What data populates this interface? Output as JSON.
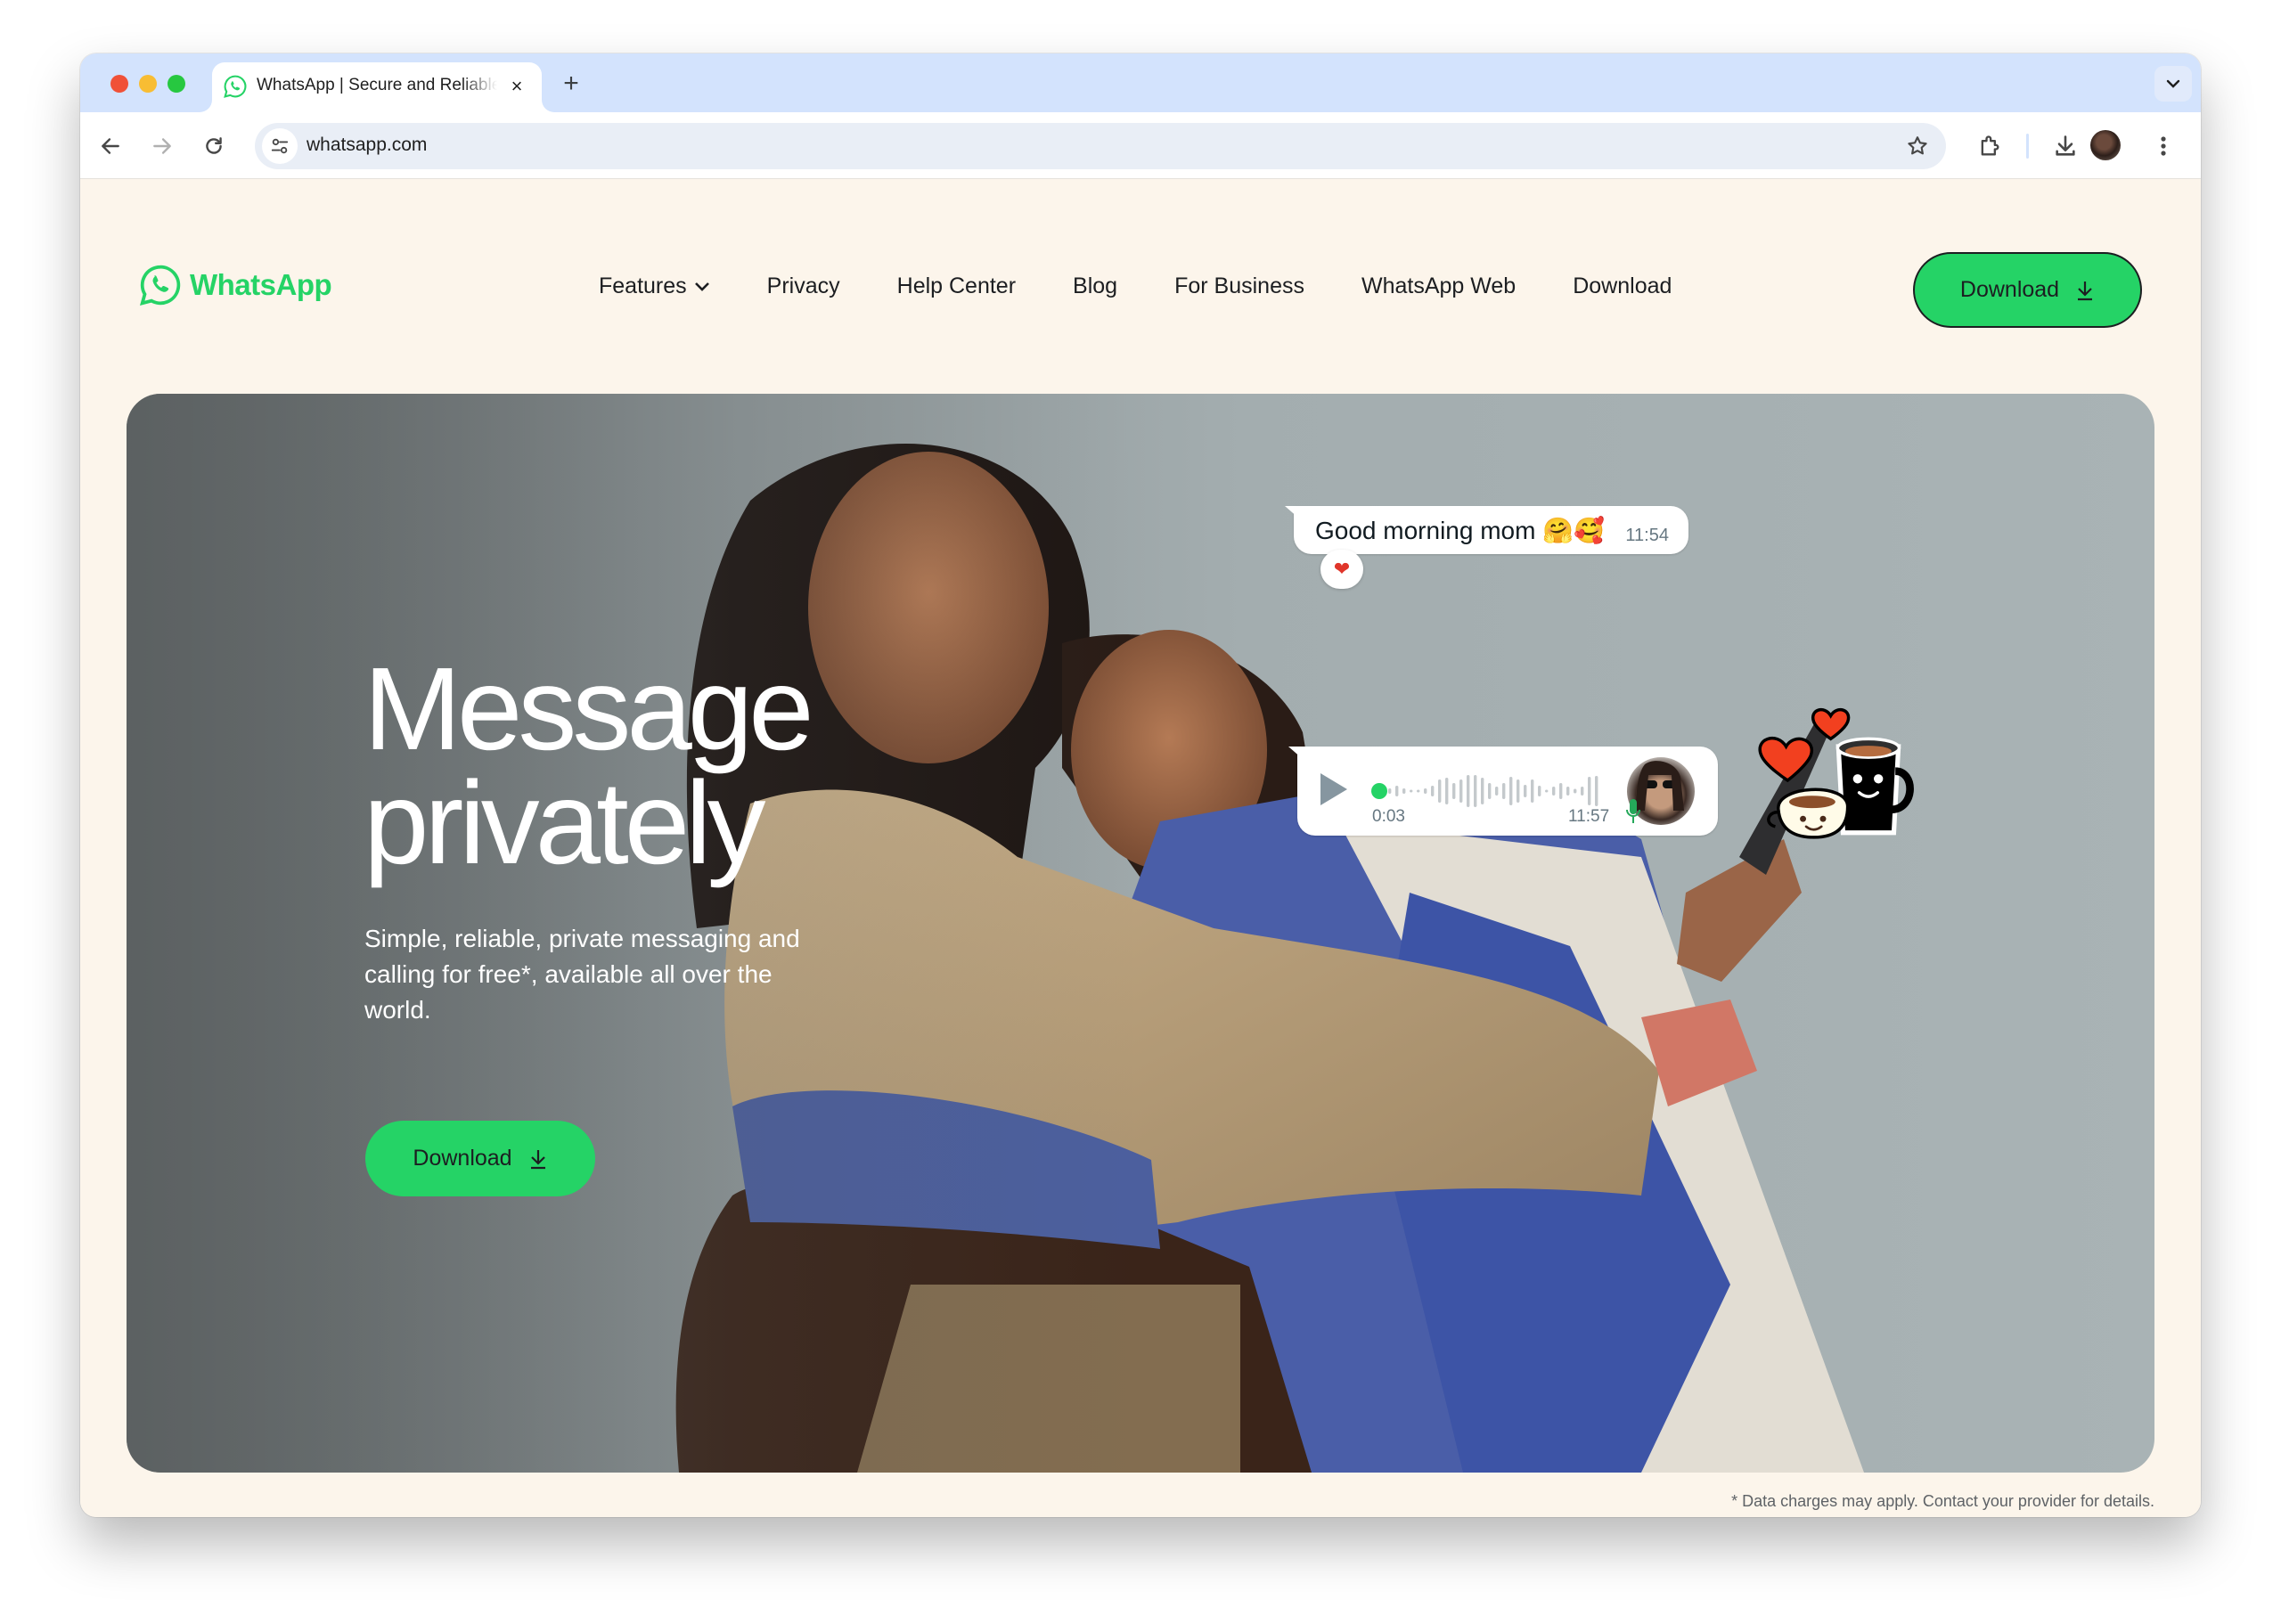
{
  "browser": {
    "tab": {
      "title": "WhatsApp | Secure and Reliable Free Private Messaging and Calling",
      "favicon": "whatsapp-icon"
    },
    "new_tab_label": "+",
    "close_tab_label": "×",
    "address": "whatsapp.com",
    "icons": [
      "back-arrow-icon",
      "forward-arrow-icon",
      "reload-icon",
      "site-settings-icon",
      "bookmark-star-icon",
      "extensions-puzzle-icon",
      "downloads-icon",
      "profile-avatar",
      "more-menu-icon",
      "tab-search-chevron-icon"
    ]
  },
  "site": {
    "brand": "WhatsApp",
    "brand_color": "#25d366",
    "nav": [
      {
        "label": "Features",
        "has_dropdown": true
      },
      {
        "label": "Privacy"
      },
      {
        "label": "Help Center"
      },
      {
        "label": "Blog"
      },
      {
        "label": "For Business"
      },
      {
        "label": "WhatsApp Web"
      },
      {
        "label": "Download"
      }
    ],
    "nav_cta": "Download"
  },
  "hero": {
    "title_line1": "Message",
    "title_line2": "privately",
    "subtitle": "Simple, reliable, private messaging and calling for free*, available all over the world.",
    "cta": "Download",
    "chat_message": {
      "text": "Good morning mom 🤗🥰",
      "time": "11:54",
      "reaction": "❤"
    },
    "voice_message": {
      "elapsed": "0:03",
      "time": "11:57",
      "progress": 0.0
    },
    "sticker": "coffee-cups-hearts-sticker"
  },
  "footnote": "* Data charges may apply. Contact your provider for details."
}
